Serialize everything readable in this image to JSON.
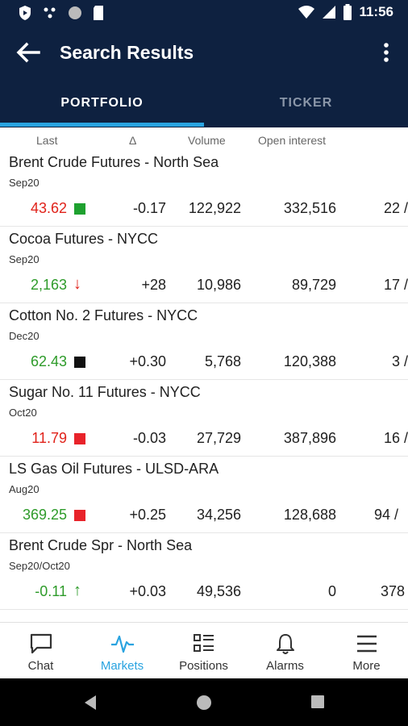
{
  "status_bar": {
    "time": "11:56"
  },
  "app_bar": {
    "title": "Search Results"
  },
  "tabs": [
    {
      "label": "PORTFOLIO",
      "active": true
    },
    {
      "label": "TICKER",
      "active": false
    }
  ],
  "columns": {
    "last": "Last",
    "delta": "Δ",
    "volume": "Volume",
    "open_interest": "Open interest"
  },
  "rows": [
    {
      "name": "Brent Crude Futures - North Sea",
      "contract": "Sep20",
      "last": "43.62",
      "last_color": "#e0221a",
      "indicator": "green-square",
      "delta": "-0.17",
      "volume": "122,922",
      "open_interest": "332,516",
      "extra": "22 /"
    },
    {
      "name": "Cocoa Futures - NYCC",
      "contract": "Sep20",
      "last": "2,163",
      "last_color": "#2e9b2a",
      "indicator": "arrow-down",
      "delta": "+28",
      "volume": "10,986",
      "open_interest": "89,729",
      "extra": "17 /"
    },
    {
      "name": "Cotton No. 2 Futures - NYCC",
      "contract": "Dec20",
      "last": "62.43",
      "last_color": "#2e9b2a",
      "indicator": "black-square",
      "delta": "+0.30",
      "volume": "5,768",
      "open_interest": "120,388",
      "extra": "3 /"
    },
    {
      "name": "Sugar No. 11 Futures - NYCC",
      "contract": "Oct20",
      "last": "11.79",
      "last_color": "#e0221a",
      "indicator": "red-square",
      "delta": "-0.03",
      "volume": "27,729",
      "open_interest": "387,896",
      "extra": "16 /"
    },
    {
      "name": "LS Gas Oil Futures - ULSD-ARA",
      "contract": "Aug20",
      "last": "369.25",
      "last_color": "#2e9b2a",
      "indicator": "red-square",
      "delta": "+0.25",
      "volume": "34,256",
      "open_interest": "128,688",
      "extra": "94 /"
    },
    {
      "name": "Brent Crude Spr - North Sea",
      "contract": "Sep20/Oct20",
      "last": "-0.11",
      "last_color": "#2e9b2a",
      "indicator": "arrow-up",
      "delta": "+0.03",
      "volume": "49,536",
      "open_interest": "0",
      "extra": "378"
    }
  ],
  "bottom_nav": [
    {
      "label": "Chat",
      "icon": "chat-icon",
      "active": false
    },
    {
      "label": "Markets",
      "icon": "markets-icon",
      "active": true
    },
    {
      "label": "Positions",
      "icon": "positions-icon",
      "active": false
    },
    {
      "label": "Alarms",
      "icon": "bell-icon",
      "active": false
    },
    {
      "label": "More",
      "icon": "menu-icon",
      "active": false
    }
  ],
  "colors": {
    "header_bg": "#0e2140",
    "accent": "#29a3e0",
    "down_red": "#e0221a",
    "up_green": "#2e9b2a"
  }
}
